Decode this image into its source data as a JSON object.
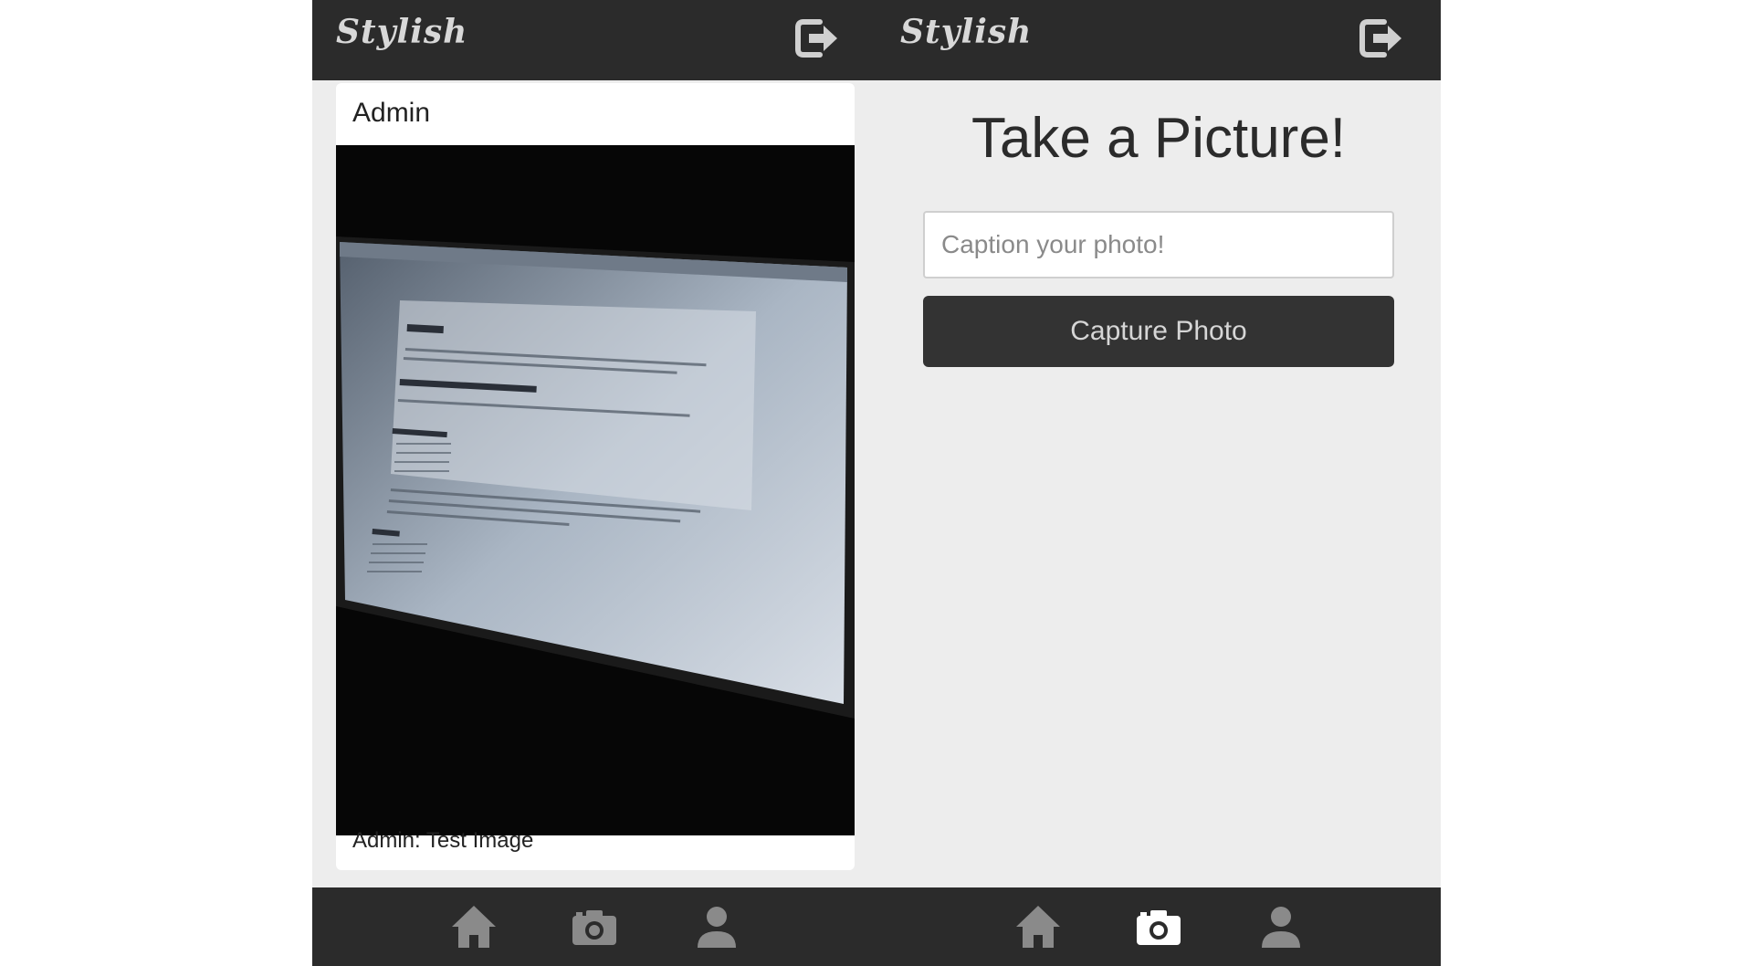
{
  "app": {
    "logo_text": "Stylish"
  },
  "colors": {
    "bar_background": "#2b2b2b",
    "screen_background": "#ededed",
    "icon_inactive": "#8a8a8a",
    "icon_active": "#ffffff",
    "button_background": "#333333"
  },
  "feed_screen": {
    "header": {
      "logo": "Stylish",
      "logout_icon": "logout-icon"
    },
    "post": {
      "author": "Admin",
      "caption": "Admin: Test Image"
    },
    "nav": {
      "items": [
        {
          "icon": "home-icon",
          "active": true
        },
        {
          "icon": "camera-icon",
          "active": false
        },
        {
          "icon": "user-icon",
          "active": false
        }
      ]
    }
  },
  "camera_screen": {
    "header": {
      "logo": "Stylish",
      "logout_icon": "logout-icon"
    },
    "title": "Take a Picture!",
    "caption_input": {
      "placeholder": "Caption your photo!",
      "value": ""
    },
    "capture_button": {
      "label": "Capture Photo"
    },
    "nav": {
      "items": [
        {
          "icon": "home-icon",
          "active": false
        },
        {
          "icon": "camera-icon",
          "active": true
        },
        {
          "icon": "user-icon",
          "active": false
        }
      ]
    }
  }
}
